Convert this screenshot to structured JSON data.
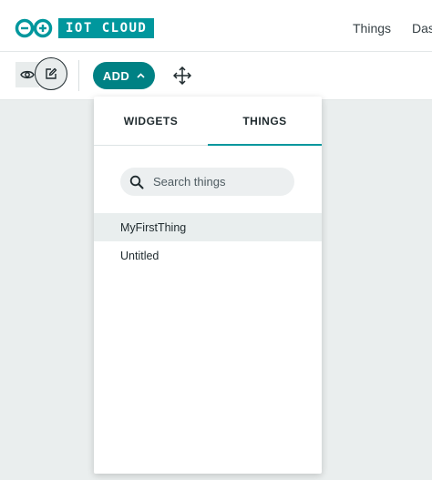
{
  "header": {
    "logo_text": "IOT CLOUD",
    "nav": [
      "Things",
      "Das"
    ]
  },
  "toolbar": {
    "add_label": "ADD"
  },
  "dropdown": {
    "tabs": [
      "WIDGETS",
      "THINGS"
    ],
    "active_tab": "THINGS",
    "search": {
      "placeholder": "Search things",
      "value": ""
    },
    "items": [
      "MyFirstThing",
      "Untitled"
    ],
    "selected_item": "MyFirstThing"
  },
  "colors": {
    "brand": "#00979d",
    "button": "#008184",
    "canvas": "#eaeeee"
  },
  "icons": [
    "arduino-logo-icon",
    "eye-icon",
    "edit-icon",
    "chevron-up-icon",
    "move-icon",
    "search-icon"
  ]
}
